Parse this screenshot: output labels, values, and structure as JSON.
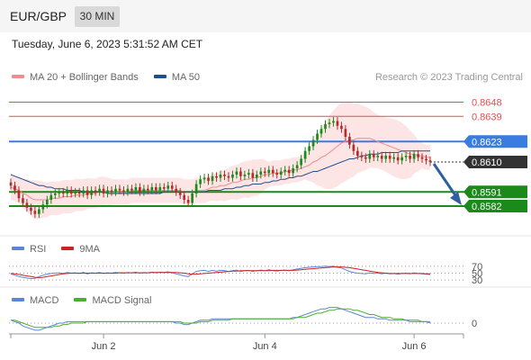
{
  "header": {
    "pair": "EUR/GBP",
    "timeframe": "30 MIN"
  },
  "datetime": "Tuesday, June 6, 2023 5:31:52 AM CET",
  "credit": "Research © 2023 Trading Central",
  "colors": {
    "ma20": "#f08c8c",
    "ma50": "#1f4e8c",
    "bands_fill": "#fde0e0",
    "up": "#1a8a1a",
    "down": "#b52a2a",
    "resistance": "#e05050",
    "pivot": "#3a7de0",
    "support": "#1a8a1a",
    "last": "#333333",
    "rsi": "#5b86d6",
    "rsi_ma": "#cc2222",
    "macd": "#5b86d6",
    "macd_signal": "#4caf2a"
  },
  "legend": {
    "ma20": "MA 20 + Bollinger Bands",
    "ma50": "MA 50",
    "rsi": "RSI",
    "rsi_ma": "9MA",
    "macd": "MACD",
    "macd_signal": "MACD Signal"
  },
  "chart_data": [
    {
      "type": "candlestick",
      "ylim": [
        0.857,
        0.8658
      ],
      "x_ticks": [
        "Jun 2",
        "Jun 4",
        "Jun 6"
      ],
      "levels": [
        {
          "value": 0.8648,
          "label": "0.8648",
          "kind": "resistance"
        },
        {
          "value": 0.8639,
          "label": "0.8639",
          "kind": "resistance"
        },
        {
          "value": 0.8623,
          "label": "0.8623",
          "kind": "pivot"
        },
        {
          "value": 0.8591,
          "label": "0.8591",
          "kind": "support"
        },
        {
          "value": 0.8582,
          "label": "0.8582",
          "kind": "support"
        }
      ],
      "last_price": {
        "value": 0.861,
        "label": "0.8610"
      },
      "forecast_arrow": {
        "from": 0.861,
        "to": 0.8582,
        "direction": "down"
      },
      "close": [
        0.8595,
        0.8592,
        0.8587,
        0.8584,
        0.8581,
        0.8579,
        0.8577,
        0.858,
        0.8583,
        0.8586,
        0.8589,
        0.859,
        0.8591,
        0.859,
        0.8592,
        0.859,
        0.8591,
        0.859,
        0.8592,
        0.8589,
        0.8592,
        0.8591,
        0.8593,
        0.859,
        0.8592,
        0.8591,
        0.8593,
        0.8592,
        0.8591,
        0.8593,
        0.8592,
        0.8594,
        0.8591,
        0.8593,
        0.8592,
        0.8594,
        0.8592,
        0.8594,
        0.8593,
        0.8595,
        0.8593,
        0.8591,
        0.8589,
        0.8586,
        0.8584,
        0.859,
        0.8596,
        0.8599,
        0.86,
        0.8598,
        0.8601,
        0.86,
        0.8602,
        0.8601,
        0.86,
        0.8602,
        0.8604,
        0.8601,
        0.8602,
        0.8603,
        0.86,
        0.8602,
        0.8604,
        0.8603,
        0.8605,
        0.8603,
        0.8602,
        0.8604,
        0.8605,
        0.8603,
        0.8606,
        0.8608,
        0.8612,
        0.8617,
        0.862,
        0.8624,
        0.8628,
        0.8631,
        0.8634,
        0.8635,
        0.8636,
        0.8633,
        0.8631,
        0.8626,
        0.8621,
        0.8617,
        0.8614,
        0.8613,
        0.8612,
        0.8615,
        0.8613,
        0.8614,
        0.8612,
        0.8614,
        0.8612,
        0.8613,
        0.8611,
        0.8613,
        0.8614,
        0.8612,
        0.8615,
        0.8613,
        0.8612,
        0.8611,
        0.861
      ],
      "ma20": [
        0.8594,
        0.8593,
        0.8592,
        0.859,
        0.8589,
        0.8587,
        0.8586,
        0.8586,
        0.8586,
        0.8586,
        0.8587,
        0.8587,
        0.8587,
        0.8588,
        0.8588,
        0.8588,
        0.8589,
        0.8589,
        0.8589,
        0.859,
        0.859,
        0.859,
        0.8591,
        0.8591,
        0.8591,
        0.8591,
        0.8591,
        0.8591,
        0.8591,
        0.8591,
        0.8592,
        0.8592,
        0.8592,
        0.8592,
        0.8592,
        0.8592,
        0.8592,
        0.8592,
        0.8592,
        0.8592,
        0.8592,
        0.8592,
        0.8592,
        0.8591,
        0.8591,
        0.8591,
        0.8592,
        0.8592,
        0.8592,
        0.8593,
        0.8594,
        0.8594,
        0.8595,
        0.8595,
        0.8596,
        0.8597,
        0.8597,
        0.8598,
        0.8599,
        0.8599,
        0.86,
        0.86,
        0.8601,
        0.8602,
        0.8602,
        0.8603,
        0.8603,
        0.8603,
        0.8604,
        0.8604,
        0.8605,
        0.8605,
        0.8606,
        0.8607,
        0.8608,
        0.861,
        0.8611,
        0.8613,
        0.8614,
        0.8616,
        0.8618,
        0.862,
        0.8622,
        0.8623,
        0.8624,
        0.8624,
        0.8625,
        0.8625,
        0.8625,
        0.8625,
        0.8624,
        0.8623,
        0.8622,
        0.8621,
        0.862,
        0.8619,
        0.8618,
        0.8617,
        0.8616,
        0.8615,
        0.8615,
        0.8614,
        0.8614,
        0.8613,
        0.8613
      ],
      "ma50": [
        0.8602,
        0.8601,
        0.86,
        0.8599,
        0.8598,
        0.8597,
        0.8596,
        0.8595,
        0.8595,
        0.8594,
        0.8594,
        0.8593,
        0.8593,
        0.8593,
        0.8592,
        0.8592,
        0.8592,
        0.8592,
        0.8591,
        0.8591,
        0.8591,
        0.8591,
        0.8591,
        0.8591,
        0.859,
        0.859,
        0.859,
        0.859,
        0.859,
        0.859,
        0.859,
        0.859,
        0.859,
        0.859,
        0.859,
        0.859,
        0.859,
        0.859,
        0.8591,
        0.8591,
        0.8591,
        0.8591,
        0.8591,
        0.8591,
        0.8591,
        0.8591,
        0.8591,
        0.8591,
        0.8591,
        0.8592,
        0.8592,
        0.8592,
        0.8592,
        0.8593,
        0.8593,
        0.8593,
        0.8594,
        0.8594,
        0.8595,
        0.8595,
        0.8596,
        0.8596,
        0.8596,
        0.8597,
        0.8597,
        0.8598,
        0.8598,
        0.8599,
        0.8599,
        0.86,
        0.86,
        0.8601,
        0.8601,
        0.8602,
        0.8603,
        0.8604,
        0.8604,
        0.8605,
        0.8606,
        0.8607,
        0.8608,
        0.8609,
        0.861,
        0.8611,
        0.8612,
        0.8612,
        0.8613,
        0.8614,
        0.8614,
        0.8615,
        0.8615,
        0.8615,
        0.8616,
        0.8616,
        0.8616,
        0.8616,
        0.8616,
        0.8617,
        0.8617,
        0.8617,
        0.8617,
        0.8617,
        0.8617,
        0.8617,
        0.8617
      ]
    },
    {
      "type": "line",
      "name": "RSI",
      "ylim": [
        20,
        80
      ],
      "levels": [
        {
          "value": 70,
          "label": "70"
        },
        {
          "value": 50,
          "label": "50"
        },
        {
          "value": 30,
          "label": "30"
        }
      ],
      "rsi": [
        48,
        44,
        40,
        38,
        36,
        34,
        35,
        40,
        44,
        47,
        49,
        50,
        51,
        49,
        52,
        50,
        51,
        49,
        52,
        48,
        51,
        50,
        52,
        49,
        51,
        50,
        52,
        51,
        50,
        52,
        51,
        53,
        50,
        52,
        51,
        53,
        51,
        53,
        52,
        54,
        51,
        48,
        45,
        42,
        40,
        48,
        55,
        57,
        58,
        55,
        58,
        56,
        58,
        57,
        55,
        57,
        59,
        55,
        57,
        58,
        55,
        57,
        59,
        57,
        60,
        57,
        56,
        58,
        59,
        57,
        60,
        62,
        64,
        66,
        67,
        68,
        69,
        69,
        70,
        69,
        70,
        67,
        65,
        60,
        55,
        52,
        50,
        49,
        48,
        51,
        49,
        50,
        48,
        50,
        48,
        49,
        47,
        49,
        50,
        48,
        51,
        49,
        48,
        47,
        46
      ],
      "rsi_ma": [
        49,
        48,
        46,
        44,
        42,
        40,
        38,
        37,
        38,
        40,
        42,
        44,
        46,
        48,
        49,
        50,
        50,
        50,
        50,
        50,
        50,
        50,
        50,
        50,
        50,
        50,
        50,
        51,
        51,
        51,
        51,
        51,
        51,
        51,
        51,
        52,
        52,
        52,
        52,
        52,
        52,
        52,
        51,
        50,
        48,
        47,
        47,
        48,
        49,
        50,
        51,
        52,
        53,
        54,
        55,
        56,
        56,
        57,
        57,
        57,
        57,
        57,
        57,
        57,
        57,
        58,
        58,
        58,
        58,
        58,
        58,
        59,
        60,
        61,
        62,
        63,
        64,
        65,
        66,
        67,
        68,
        68,
        68,
        67,
        66,
        64,
        62,
        60,
        58,
        56,
        54,
        52,
        51,
        50,
        49,
        49,
        49,
        49,
        49,
        49,
        49,
        49,
        49,
        48,
        48
      ]
    },
    {
      "type": "line",
      "name": "MACD",
      "ylim": [
        -0.0012,
        0.0012
      ],
      "levels": [
        {
          "value": 0,
          "label": "0"
        }
      ],
      "macd": [
        0.0002,
        0.0001,
        0.0,
        -0.0002,
        -0.0003,
        -0.0004,
        -0.0005,
        -0.0005,
        -0.0004,
        -0.0003,
        -0.0002,
        -0.0001,
        0.0,
        0.0,
        0.0001,
        0.0001,
        0.0001,
        0.0001,
        0.0001,
        0.0001,
        0.0001,
        0.0001,
        0.0001,
        0.0001,
        0.0001,
        0.0001,
        0.0001,
        0.0001,
        0.0001,
        0.0001,
        0.0001,
        0.0001,
        0.0001,
        0.0001,
        0.0001,
        0.0001,
        0.0001,
        0.0001,
        0.0001,
        0.0001,
        0.0001,
        0.0,
        0.0,
        -0.0001,
        -0.0001,
        0.0,
        0.0001,
        0.0002,
        0.0002,
        0.0002,
        0.0003,
        0.0003,
        0.0003,
        0.0003,
        0.0003,
        0.0003,
        0.0003,
        0.0003,
        0.0003,
        0.0003,
        0.0003,
        0.0003,
        0.0003,
        0.0003,
        0.0003,
        0.0003,
        0.0003,
        0.0003,
        0.0003,
        0.0003,
        0.0004,
        0.0004,
        0.0005,
        0.0006,
        0.0007,
        0.0008,
        0.0009,
        0.001,
        0.001,
        0.0011,
        0.0011,
        0.0011,
        0.001,
        0.0009,
        0.0008,
        0.0007,
        0.0006,
        0.0005,
        0.0004,
        0.0004,
        0.0004,
        0.0003,
        0.0003,
        0.0003,
        0.0002,
        0.0002,
        0.0002,
        0.0002,
        0.0002,
        0.0001,
        0.0001,
        0.0001,
        0.0001,
        0.0001,
        0.0
      ],
      "signal": [
        0.0002,
        0.0002,
        0.0001,
        0.0,
        -0.0001,
        -0.0002,
        -0.0003,
        -0.0003,
        -0.0003,
        -0.0003,
        -0.0003,
        -0.0002,
        -0.0002,
        -0.0001,
        -0.0001,
        0.0,
        0.0,
        0.0,
        0.0,
        0.0001,
        0.0001,
        0.0001,
        0.0001,
        0.0001,
        0.0001,
        0.0001,
        0.0001,
        0.0001,
        0.0001,
        0.0001,
        0.0001,
        0.0001,
        0.0001,
        0.0001,
        0.0001,
        0.0001,
        0.0001,
        0.0001,
        0.0001,
        0.0001,
        0.0001,
        0.0001,
        0.0001,
        0.0,
        0.0,
        0.0,
        0.0,
        0.0001,
        0.0001,
        0.0001,
        0.0002,
        0.0002,
        0.0002,
        0.0002,
        0.0002,
        0.0003,
        0.0003,
        0.0003,
        0.0003,
        0.0003,
        0.0003,
        0.0003,
        0.0003,
        0.0003,
        0.0003,
        0.0003,
        0.0003,
        0.0003,
        0.0003,
        0.0003,
        0.0003,
        0.0004,
        0.0004,
        0.0004,
        0.0005,
        0.0006,
        0.0007,
        0.0007,
        0.0008,
        0.0009,
        0.0009,
        0.001,
        0.001,
        0.001,
        0.001,
        0.0009,
        0.0009,
        0.0008,
        0.0007,
        0.0006,
        0.0006,
        0.0005,
        0.0004,
        0.0004,
        0.0004,
        0.0003,
        0.0003,
        0.0003,
        0.0002,
        0.0002,
        0.0002,
        0.0002,
        0.0001,
        0.0001,
        0.0001
      ]
    }
  ]
}
